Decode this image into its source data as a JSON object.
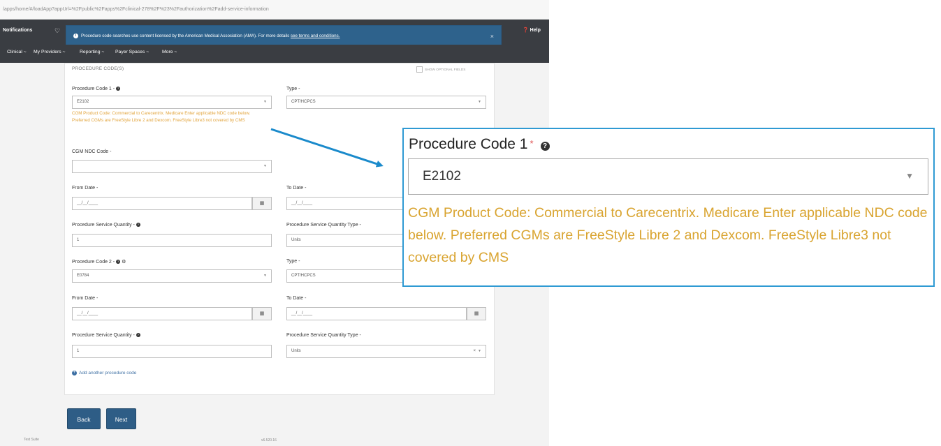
{
  "browser": {
    "url": "/apps/home/#/loadApp?appUrl=%2Fpublic%2Fapps%2Fclinical-278%2F%23%2Fauthorization%2Fadd-service-information"
  },
  "topbar": {
    "notifications": "Notifications",
    "help": "Help"
  },
  "banner": {
    "text": "Procedure code searches use content licensed by the American Medical Association (AMA). For more details",
    "link": "see terms and conditions.",
    "close": "×"
  },
  "menu": {
    "items": [
      "Clinical ~",
      "My Providers ~",
      "Reporting ~",
      "Payer Spaces ~",
      "More ~"
    ]
  },
  "form": {
    "section_title": "PROCEDURE CODE(S)",
    "show_optional": "SHOW OPTIONAL FIELDS",
    "pc1_label": "Procedure Code 1 -",
    "pc1_value": "E2102",
    "type_label": "Type -",
    "type1_value": "CPT/HCPCS",
    "pc1_note": "CGM Product Code: Commercial to Carecentrix. Medicare Enter applicable NDC code below. Preferred CGMs are FreeStyle Libre 2 and Dexcom. FreeStyle Libre3 not covered by CMS",
    "ndc_label": "CGM NDC Code -",
    "from_date_label": "From Date -",
    "to_date_label": "To Date -",
    "date_placeholder": "__/__/____",
    "qty_label": "Procedure Service Quantity -",
    "qty_type_label": "Procedure Service Quantity Type -",
    "qty1_value": "1",
    "qty_type1_value": "Units",
    "pc2_label": "Procedure Code 2 -",
    "pc2_value": "E0784",
    "type2_value": "CPT/HCPCS",
    "qty2_value": "1",
    "qty_type2_value": "Units",
    "add_code": "Add another procedure code"
  },
  "buttons": {
    "back": "Back",
    "next": "Next"
  },
  "footer": {
    "test_suite": "Test Suite",
    "version": "v6.520.16"
  },
  "zoom": {
    "label": "Procedure Code 1",
    "required_mark": "*",
    "value": "E2102",
    "note": "CGM Product Code: Commercial to Carecentrix. Medicare Enter applicable NDC code below. Preferred CGMs are FreeStyle Libre 2 and Dexcom. FreeStyle Libre3 not covered by CMS"
  },
  "colors": {
    "callout_border": "#2f9ad3",
    "arrow": "#1a8acb",
    "warning_text": "#d9a430",
    "nav_bar": "#3a3d42",
    "banner": "#2e628c",
    "button": "#2e5d86"
  }
}
